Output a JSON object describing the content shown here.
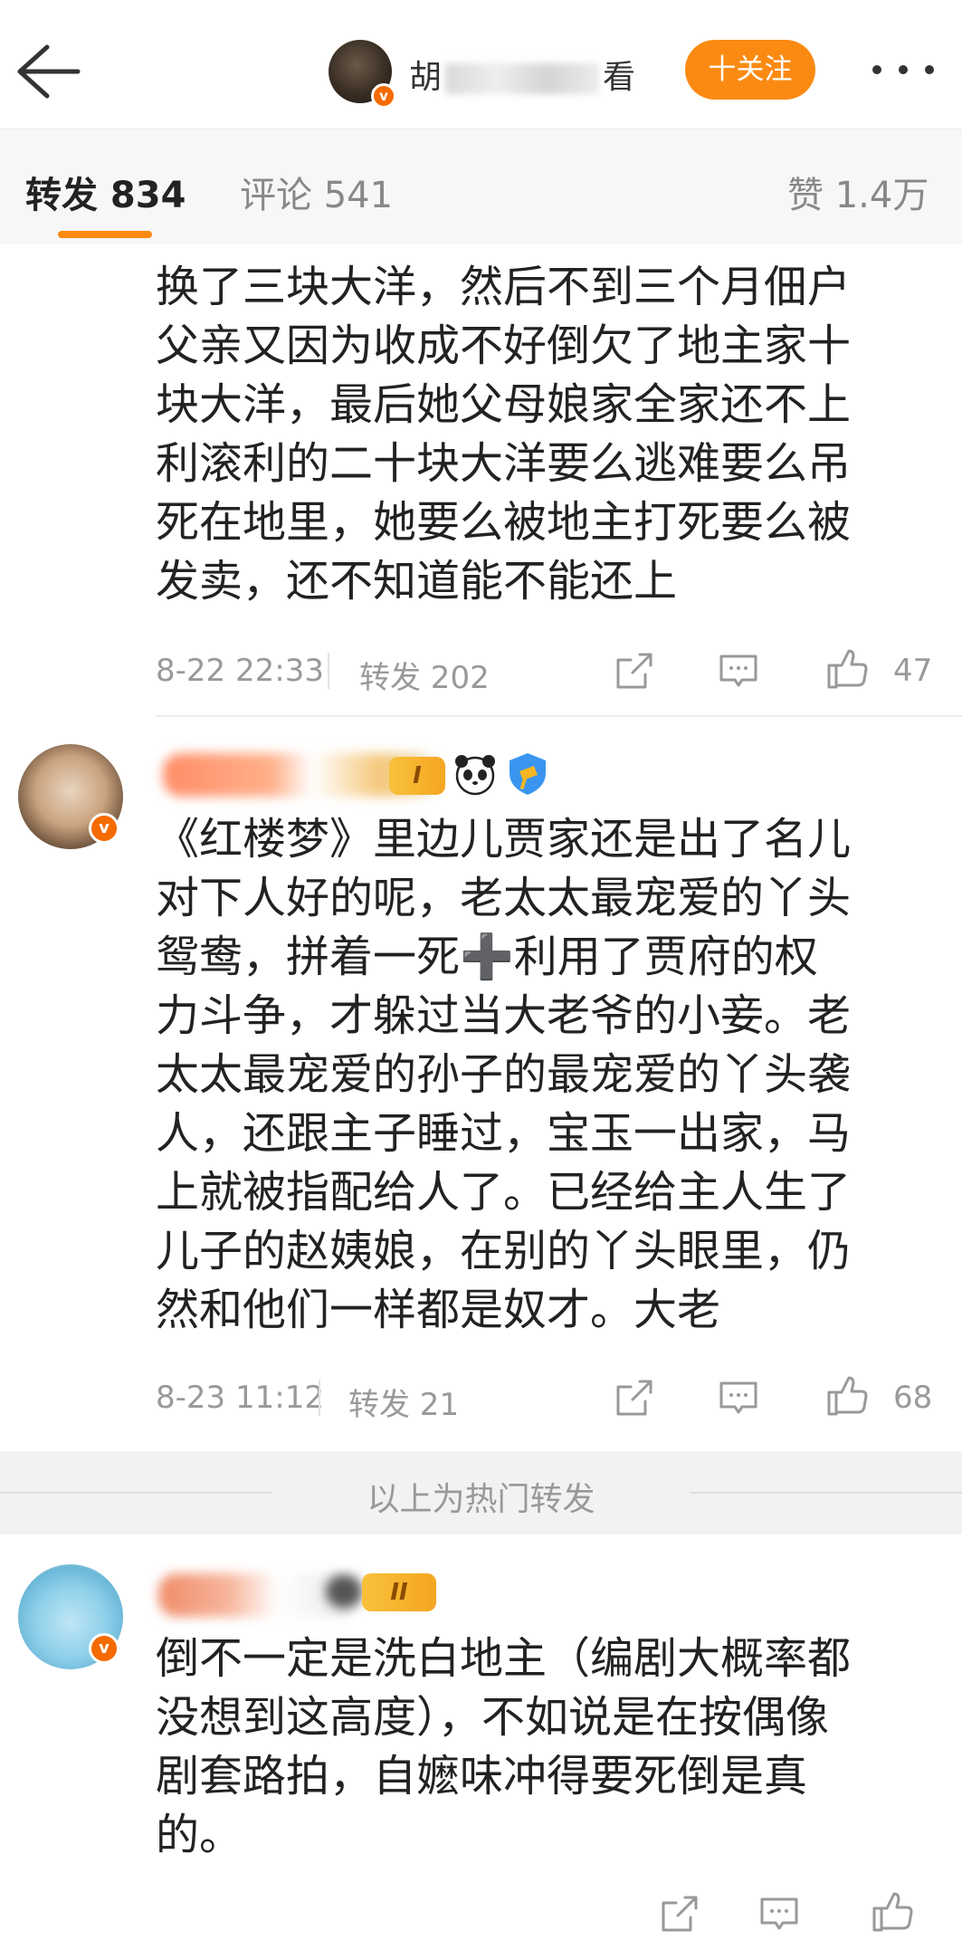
{
  "header": {
    "name_visible_start": "胡",
    "name_visible_end": "看",
    "follow_label": "十关注",
    "verified_mark": "v"
  },
  "tabs": [
    {
      "label": "转发 834"
    },
    {
      "label": "评论 541"
    },
    {
      "label": "赞 1.4万"
    }
  ],
  "comment1": {
    "lines": [
      "换了三块大洋，然后不到三个月佃户",
      "父亲又因为收成不好倒欠了地主家十",
      "块大洋，最后她父母娘家全家还不上",
      "利滚利的二十块大洋要么逃难要么吊",
      "死在地里，她要么被地主打死要么被",
      "发卖，还不知道能不能还上"
    ],
    "time": "8-22 22:33",
    "repost": "转发 202",
    "likes": "47"
  },
  "comment2": {
    "vip_level": "I",
    "lines": [
      "《红楼梦》里边儿贾家还是出了名儿",
      "对下人好的呢，老太太最宠爱的丫头",
      "鸳鸯，拼着一死➕利用了贾府的权",
      "力斗争，才躲过当大老爷的小妾。老",
      "太太最宠爱的孙子的最宠爱的丫头袭",
      "人，还跟主子睡过，宝玉一出家，马",
      "上就被指配给人了。已经给主人生了",
      "儿子的赵姨娘，在别的丫头眼里，仍",
      "然和他们一样都是奴才。大老"
    ],
    "time": "8-23 11:12",
    "repost": "转发 21",
    "likes": "68"
  },
  "hot_label": "以上为热门转发",
  "comment3": {
    "vip_level": "II",
    "lines": [
      "倒不一定是洗白地主（编剧大概率都",
      "没想到这高度），不如说是在按偶像",
      "剧套路拍，自嬷味冲得要死倒是真",
      "的。"
    ]
  },
  "colors": {
    "accent": "#fb8a12",
    "verified": "#f56b00",
    "meta_text": "#999999",
    "body_text": "#222222"
  }
}
